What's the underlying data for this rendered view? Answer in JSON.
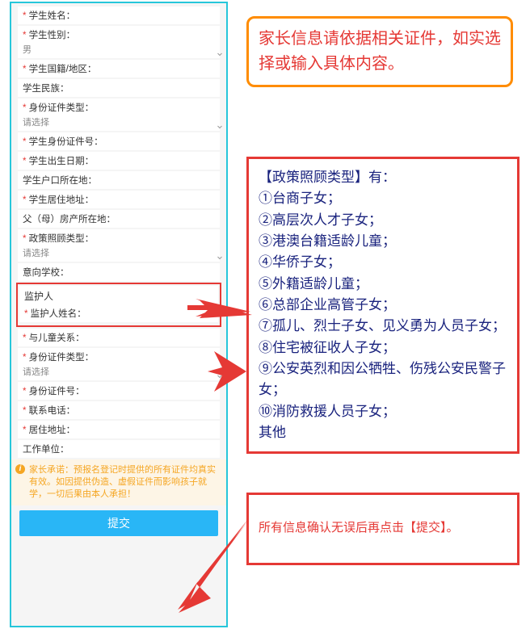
{
  "form": {
    "items": [
      {
        "label": "学生姓名：",
        "req": true,
        "select": false
      },
      {
        "label": "学生性别：",
        "req": true,
        "select": true,
        "value": "男"
      },
      {
        "label": "学生国籍/地区：",
        "req": true,
        "select": false
      },
      {
        "label": "学生民族：",
        "req": false,
        "select": false
      },
      {
        "label": "身份证件类型：",
        "req": true,
        "select": true,
        "value": "请选择"
      },
      {
        "label": "学生身份证件号：",
        "req": true,
        "select": false
      },
      {
        "label": "学生出生日期：",
        "req": true,
        "select": false
      },
      {
        "label": "学生户口所在地：",
        "req": false,
        "select": false
      },
      {
        "label": "学生居住地址：",
        "req": true,
        "select": false
      },
      {
        "label": "父（母）房产所在地：",
        "req": false,
        "select": false
      },
      {
        "label": "政策照顾类型：",
        "req": true,
        "select": true,
        "value": "请选择"
      }
    ],
    "school_label": "意向学校：",
    "guardian_header": "监护人",
    "guardian_name_label": "监护人姓名：",
    "guardian_name_req": true,
    "post_items": [
      {
        "label": "与儿童关系：",
        "req": true,
        "select": false
      },
      {
        "label": "身份证件类型：",
        "req": true,
        "select": true,
        "value": "请选择"
      },
      {
        "label": "身份证件号：",
        "req": true,
        "select": false
      },
      {
        "label": "联系电话：",
        "req": true,
        "select": false
      },
      {
        "label": "居住地址：",
        "req": true,
        "select": false
      },
      {
        "label": "工作单位：",
        "req": false,
        "select": false
      }
    ],
    "notice": "家长承诺：预报名登记时提供的所有证件均真实有效。如因提供伪造、虚假证件而影响孩子就学，一切后果由本人承担！",
    "submit_label": "提交"
  },
  "callouts": {
    "c1": "家长信息请依据相关证件，如实选择或输入具体内容。",
    "c2": {
      "head": "【政策照顾类型】有：",
      "r1": "①台商子女；",
      "r2": "②高层次人才子女；",
      "r3": "③港澳台籍适龄儿童；",
      "r4": "④华侨子女；",
      "r5": "⑤外籍适龄儿童；",
      "r6": "⑥总部企业高管子女；",
      "r7": "⑦孤儿、烈士子女、见义勇为人员子女；",
      "r8": "⑧住宅被征收人子女；",
      "r9": "⑨公安英烈和因公牺牲、伤残公安民警子女；",
      "r10": "⑩消防救援人员子女；",
      "r11": "其他"
    },
    "c3": "所有信息确认无误后再点击【提交】。"
  }
}
